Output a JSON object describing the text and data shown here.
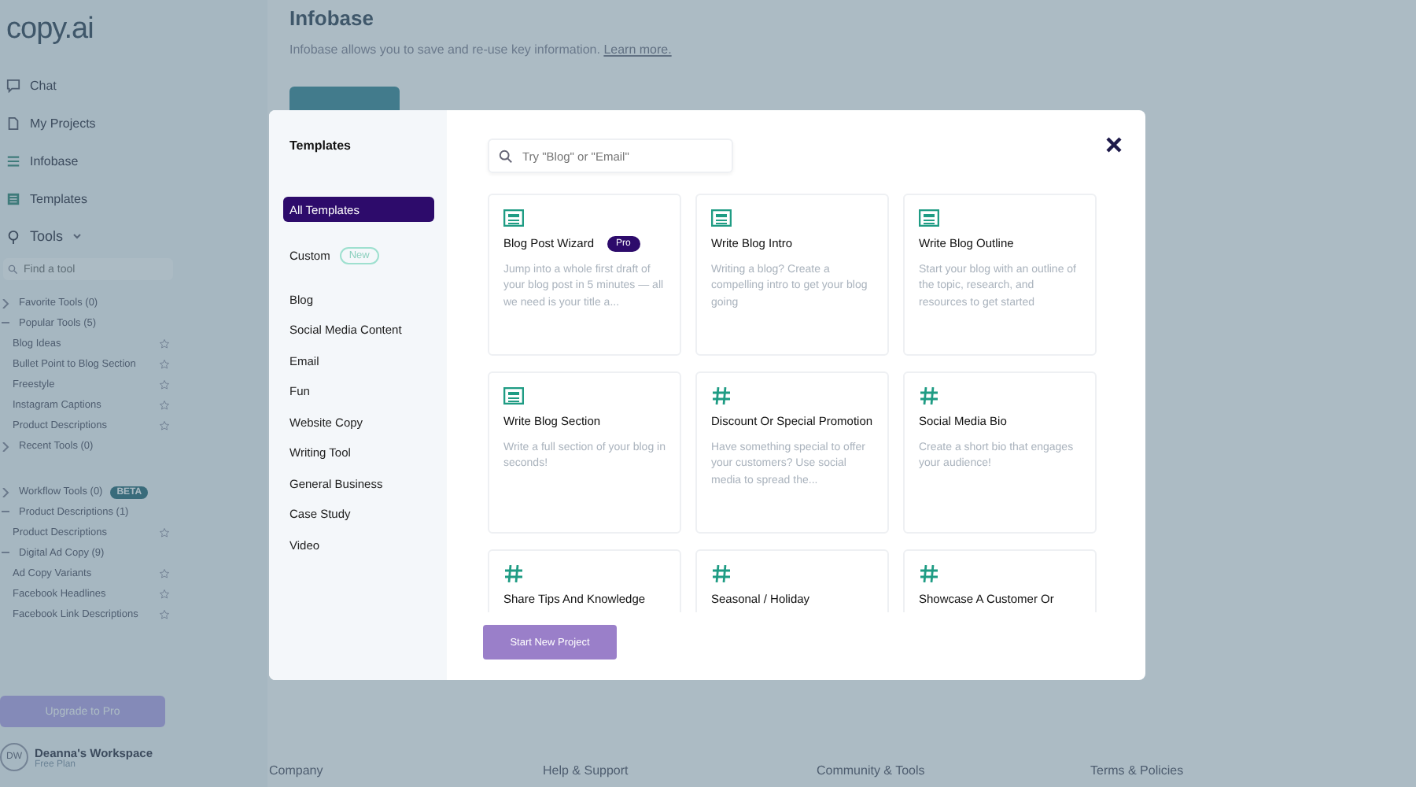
{
  "sidebar": {
    "logo": "copy.ai",
    "nav": [
      {
        "label": "Chat",
        "kind": "chat"
      },
      {
        "label": "My Projects",
        "kind": "doc"
      },
      {
        "label": "Infobase",
        "kind": "list"
      },
      {
        "label": "Templates",
        "kind": "grid"
      }
    ],
    "tools_label": "Tools",
    "search": {
      "placeholder": "Find a tool"
    },
    "groups": [
      {
        "label": "Favorite Tools (0)",
        "expanded": false
      },
      {
        "label": "Popular Tools (5)",
        "expanded": true,
        "children": [
          {
            "label": "Blog Ideas"
          },
          {
            "label": "Bullet Point to Blog Section"
          },
          {
            "label": "Freestyle"
          },
          {
            "label": "Instagram Captions"
          },
          {
            "label": "Product Descriptions"
          }
        ]
      },
      {
        "label": "Recent Tools (0)",
        "expanded": false
      },
      {
        "label": "Workflow Tools (0)",
        "expanded": false,
        "badge": "BETA"
      },
      {
        "label": "Product Descriptions (1)",
        "expanded": true,
        "children": [
          {
            "label": "Product Descriptions"
          }
        ]
      },
      {
        "label": "Digital Ad Copy (9)",
        "expanded": true,
        "children": [
          {
            "label": "Ad Copy Variants"
          },
          {
            "label": "Facebook Headlines"
          },
          {
            "label": "Facebook Link Descriptions"
          }
        ]
      }
    ],
    "upgrade_button": "Upgrade to Pro",
    "workspace": {
      "initials": "DW",
      "name": "Deanna's Workspace",
      "plan": "Free Plan"
    }
  },
  "main": {
    "title": "Infobase",
    "description": "Infobase allows you to save and re-use key information.",
    "link": "Learn more."
  },
  "footer": [
    "Company",
    "Help & Support",
    "Community & Tools",
    "Terms & Policies"
  ],
  "modal": {
    "title": "Templates",
    "categories": [
      {
        "label": "All Templates",
        "selected": true
      },
      {
        "label": "Custom",
        "badge": "New",
        "selected": false
      },
      {
        "label": "Blog",
        "selected": false
      },
      {
        "label": "Social Media Content",
        "selected": false
      },
      {
        "label": "Email",
        "selected": false
      },
      {
        "label": "Fun",
        "selected": false
      },
      {
        "label": "Website Copy",
        "selected": false
      },
      {
        "label": "Writing Tool",
        "selected": false
      },
      {
        "label": "General Business",
        "selected": false
      },
      {
        "label": "Case Study",
        "selected": false
      },
      {
        "label": "Video",
        "selected": false
      }
    ],
    "search": {
      "placeholder": "Try \"Blog\" or \"Email\""
    },
    "cards": [
      {
        "kind": "blog",
        "title": "Blog Post Wizard",
        "badge": "Pro",
        "description": "Jump into a whole first draft of your blog post in 5 minutes — all we need is your title a..."
      },
      {
        "kind": "blog",
        "title": "Write Blog Intro",
        "description": "Writing a blog? Create a compelling intro to get your blog going"
      },
      {
        "kind": "blog",
        "title": "Write Blog Outline",
        "description": "Start your blog with an outline of the topic, research, and resources to get started"
      },
      {
        "kind": "blog",
        "title": "Write Blog Section",
        "description": "Write a full section of your blog in seconds!"
      },
      {
        "kind": "social",
        "title": "Discount Or Special Promotion",
        "description": "Have something special to offer your customers? Use social media to spread the..."
      },
      {
        "kind": "social",
        "title": "Social Media Bio",
        "description": "Create a short bio that engages your audience!"
      },
      {
        "kind": "social",
        "title": "Share Tips And Knowledge"
      },
      {
        "kind": "social",
        "title": "Seasonal / Holiday"
      },
      {
        "kind": "social",
        "title": "Showcase A Customer Or"
      }
    ],
    "start_button": "Start New Project"
  }
}
